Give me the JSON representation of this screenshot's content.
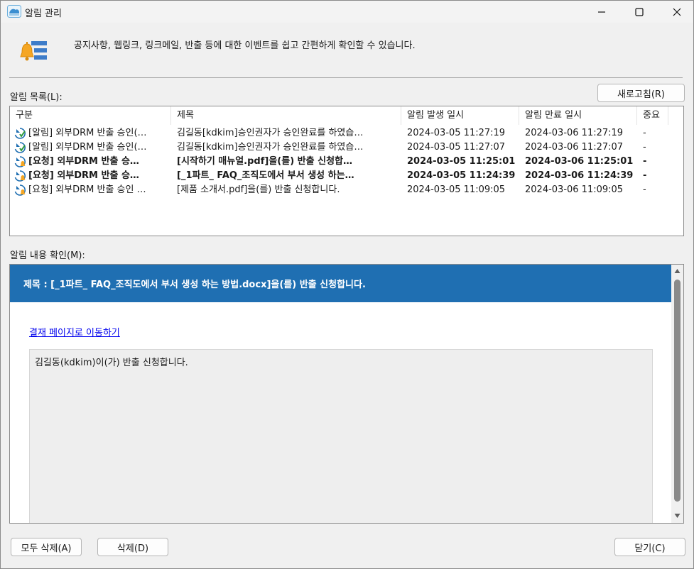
{
  "window": {
    "title": "알림 관리"
  },
  "header": {
    "description": "공지사항, 웹링크, 링크메일, 반출 등에 대한 이벤트를 쉽고 간편하게 확인할 수 있습니다."
  },
  "list_section": {
    "label": "알림 목록(L):",
    "refresh_label": "새로고침(R)",
    "columns": [
      "구분",
      "제목",
      "알림 발생 일시",
      "알림 만료 일시",
      "중요"
    ],
    "rows": [
      {
        "type": "[알림] 외부DRM 반출 승인(…",
        "subject": "김길동[kdkim]승인권자가 승인완료를 하였습…",
        "start": "2024-03-05 11:27:19",
        "end": "2024-03-06 11:27:19",
        "important": "-",
        "bold": false,
        "icon": "approved-icon"
      },
      {
        "type": "[알림] 외부DRM 반출 승인(…",
        "subject": "김길동[kdkim]승인권자가 승인완료를 하였습…",
        "start": "2024-03-05 11:27:07",
        "end": "2024-03-06 11:27:07",
        "important": "-",
        "bold": false,
        "icon": "approved-icon"
      },
      {
        "type": "[요청] 외부DRM 반출 승…",
        "subject": "[시작하기 매뉴얼.pdf]을(를) 반출 신청합…",
        "start": "2024-03-05 11:25:01",
        "end": "2024-03-06 11:25:01",
        "important": "-",
        "bold": true,
        "icon": "request-icon"
      },
      {
        "type": "[요청] 외부DRM 반출 승…",
        "subject": "[_1파트_ FAQ_조직도에서 부서 생성 하는…",
        "start": "2024-03-05 11:24:39",
        "end": "2024-03-06 11:24:39",
        "important": "-",
        "bold": true,
        "icon": "request-icon"
      },
      {
        "type": "[요청] 외부DRM 반출 승인 …",
        "subject": "[제품 소개서.pdf]을(를) 반출 신청합니다.",
        "start": "2024-03-05 11:09:05",
        "end": "2024-03-06 11:09:05",
        "important": "-",
        "bold": false,
        "icon": "request-icon"
      }
    ]
  },
  "detail_section": {
    "label": "알림 내용 확인(M):",
    "title": "제목 : [_1파트_ FAQ_조직도에서 부서 생성 하는 방법.docx]을(를) 반출 신청합니다.",
    "link": "결재 페이지로 이동하기",
    "body": "김길동(kdkim)이(가) 반출 신청합니다."
  },
  "footer": {
    "delete_all_label": "모두 삭제(A)",
    "delete_label": "삭제(D)",
    "close_label": "닫기(C)"
  },
  "colors": {
    "accent": "#1f6fb2"
  }
}
